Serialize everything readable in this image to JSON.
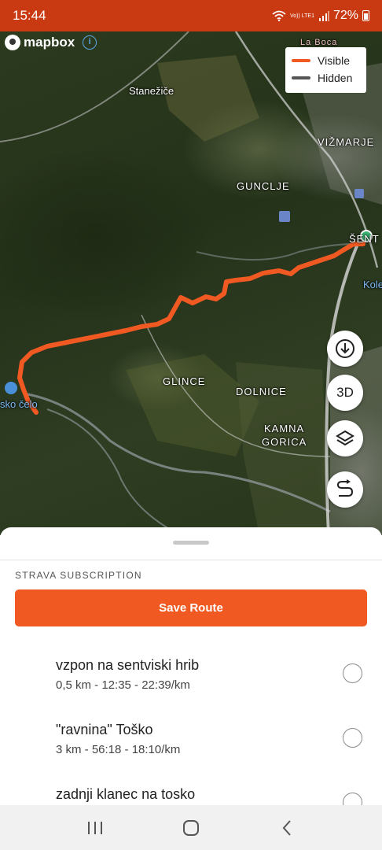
{
  "status_bar": {
    "time": "15:44",
    "network": "Vo)) LTE1",
    "battery": "72%"
  },
  "map": {
    "attribution": "mapbox",
    "legend": {
      "visible_label": "Visible",
      "visible_color": "#f05a22",
      "hidden_label": "Hidden",
      "hidden_color": "#555555"
    },
    "places": {
      "la_boca": "La Boca",
      "stanezice": "Stanežiče",
      "vizmarje": "VIŽMARJE",
      "gunclje": "GUNCLJE",
      "sent": "ŠENT",
      "kole": "Kole",
      "glince": "GLINCE",
      "dolnice": "DOLNICE",
      "kamna": "KAMNA",
      "gorica": "GORICA",
      "sko_celo": "sko čelo"
    },
    "buttons": {
      "download_icon": "download-icon",
      "three_d_label": "3D",
      "layers_icon": "layers-icon",
      "route_icon": "route-icon"
    }
  },
  "sheet": {
    "section_label": "STRAVA SUBSCRIPTION",
    "save_route_label": "Save Route",
    "segments": [
      {
        "name": "vzpon na sentviski hrib",
        "meta": "0,5 km - 12:35 - 22:39/km"
      },
      {
        "name": "\"ravnina\" Toško",
        "meta": "3 km - 56:18 - 18:10/km"
      },
      {
        "name": "zadnji klanec na tosko",
        "meta": ""
      }
    ]
  }
}
